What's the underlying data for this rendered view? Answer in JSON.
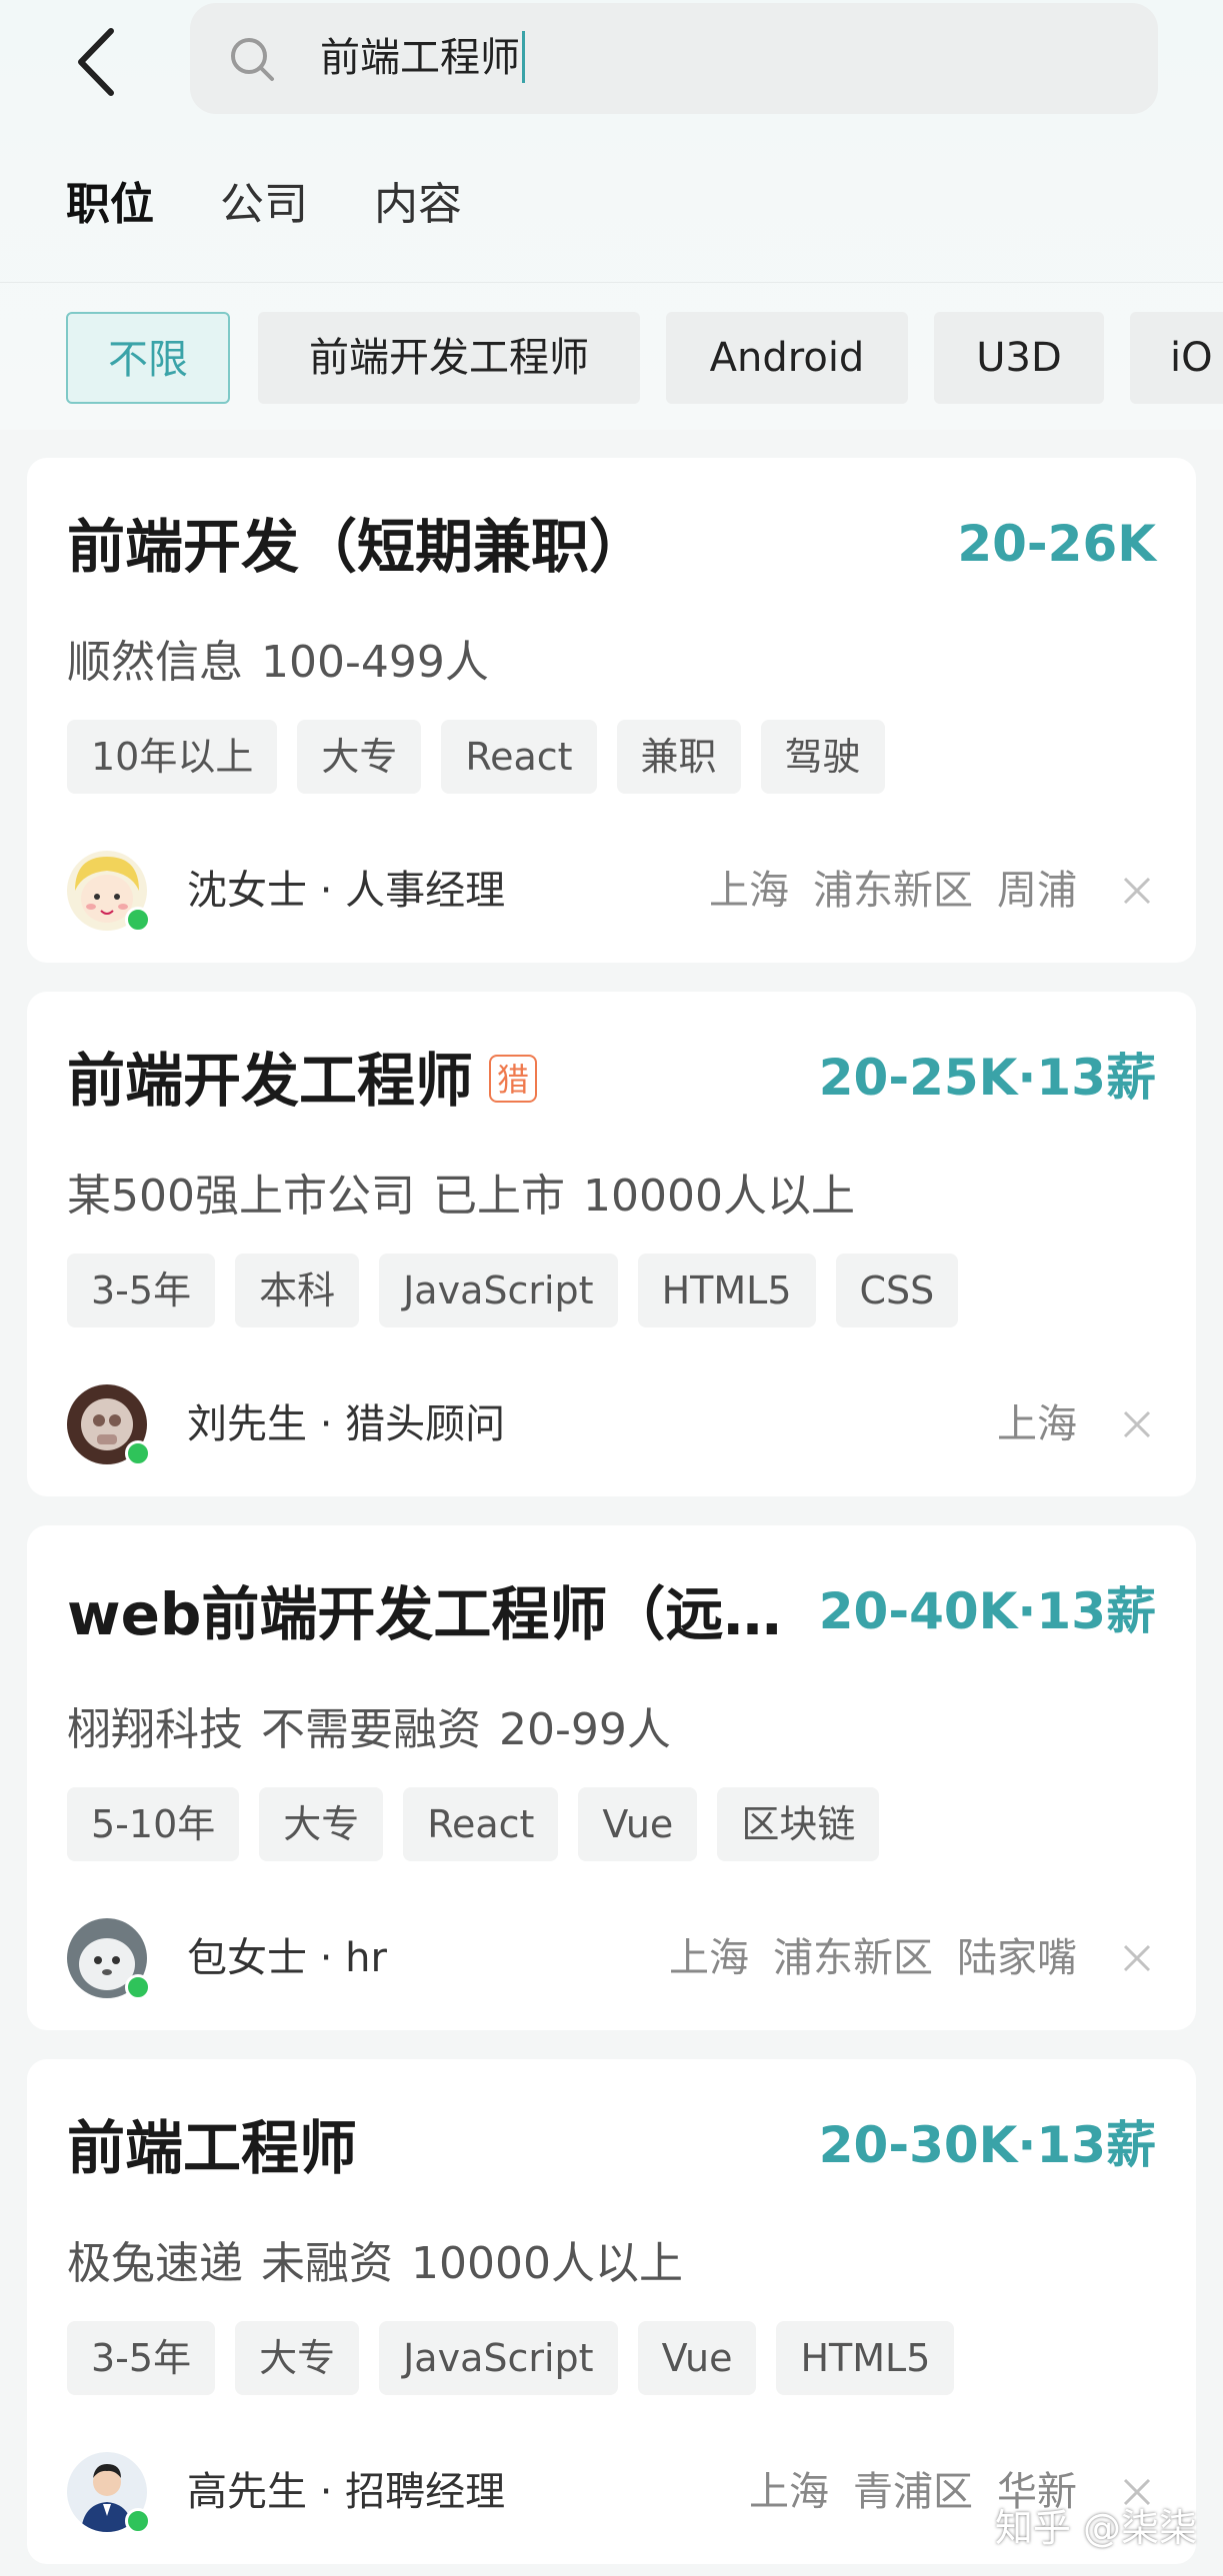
{
  "header": {
    "search_value": "前端工程师"
  },
  "tabs": [
    "职位",
    "公司",
    "内容"
  ],
  "filters": [
    "不限",
    "前端开发工程师",
    "Android",
    "U3D",
    "iO"
  ],
  "jobs": [
    {
      "title": "前端开发（短期兼职）",
      "salary": "20-26K",
      "company": [
        "顺然信息",
        "100-499人"
      ],
      "tags": [
        "10年以上",
        "大专",
        "React",
        "兼职",
        "驾驶"
      ],
      "recruiter": "沈女士 · 人事经理",
      "location": [
        "上海",
        "浦东新区",
        "周浦"
      ]
    },
    {
      "title": "前端开发工程师",
      "badge": "猎",
      "salary": "20-25K·13薪",
      "company": [
        "某500强上市公司",
        "已上市",
        "10000人以上"
      ],
      "tags": [
        "3-5年",
        "本科",
        "JavaScript",
        "HTML5",
        "CSS"
      ],
      "recruiter": "刘先生 · 猎头顾问",
      "location": [
        "上海"
      ]
    },
    {
      "title": "web前端开发工程师（远程...",
      "salary": "20-40K·13薪",
      "company": [
        "栩翔科技",
        "不需要融资",
        "20-99人"
      ],
      "tags": [
        "5-10年",
        "大专",
        "React",
        "Vue",
        "区块链"
      ],
      "recruiter": "包女士 · hr",
      "location": [
        "上海",
        "浦东新区",
        "陆家嘴"
      ]
    },
    {
      "title": "前端工程师",
      "salary": "20-30K·13薪",
      "company": [
        "极兔速递",
        "未融资",
        "10000人以上"
      ],
      "tags": [
        "3-5年",
        "大专",
        "JavaScript",
        "Vue",
        "HTML5"
      ],
      "recruiter": "高先生 · 招聘经理",
      "location": [
        "上海",
        "青浦区",
        "华新"
      ]
    }
  ],
  "watermark": "知乎 @柒柒",
  "colors": {
    "accent": "#3aa3a8",
    "hunter_badge": "#ef7a4e",
    "online": "#2fc35a"
  }
}
